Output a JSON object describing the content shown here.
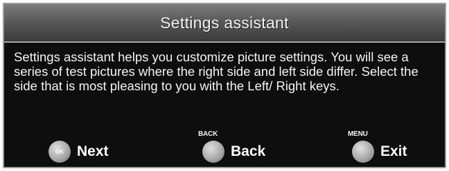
{
  "dialog": {
    "title": "Settings assistant",
    "description": "Settings assistant helps you customize picture settings. You will see a series of test pictures where the right side and left side differ. Select the side that is most pleasing to you with the Left/ Right keys."
  },
  "footer": {
    "next": {
      "button_glyph": "OK",
      "label": "Next"
    },
    "back": {
      "key_caption": "BACK",
      "label": "Back"
    },
    "exit": {
      "key_caption": "MENU",
      "label": "Exit"
    }
  },
  "colors": {
    "panel_background": "#0e0e0e",
    "title_bar": "#5a5a5a",
    "text": "#f4f4f4",
    "key_button": "#a9a9a9"
  }
}
